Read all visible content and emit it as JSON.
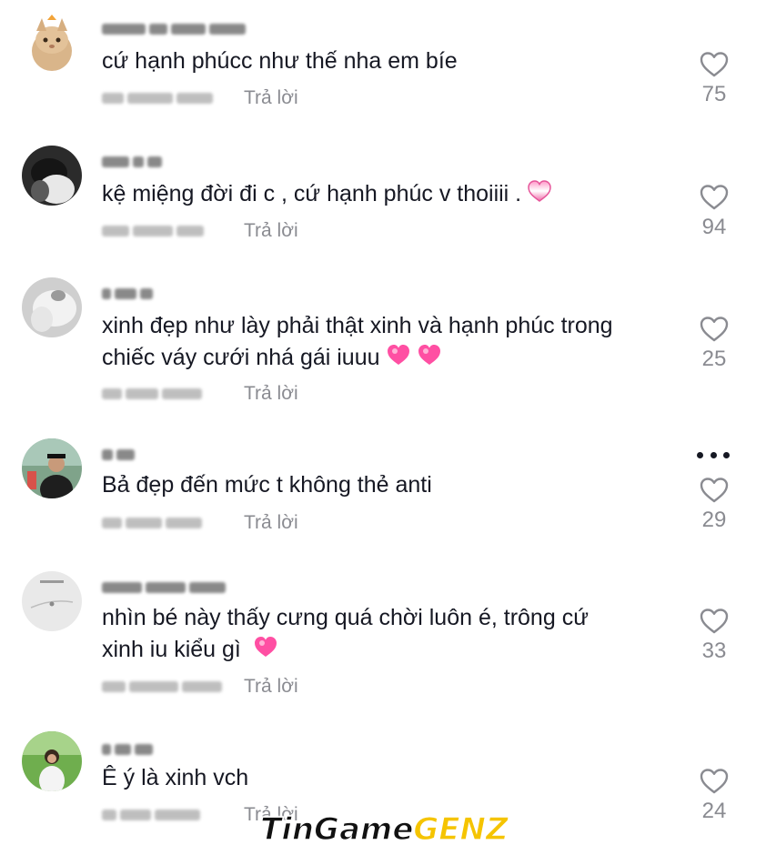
{
  "reply_label": "Trả lời",
  "comments": [
    {
      "text": "cứ hạnh phúcc như thế nha em bíe",
      "emoji": "",
      "likes": "75"
    },
    {
      "text": "kệ miệng đời đi c , cứ hạnh phúc v thoiiii .",
      "emoji": "pink-heart",
      "likes": "94"
    },
    {
      "text": "xinh đẹp như lày phải thật xinh và hạnh phúc trong\nchiếc váy cưới nhá gái iuuu",
      "emoji": "sparkling-heart x2",
      "likes": "25"
    },
    {
      "text": "Bả đẹp đến mức t không thẻ anti",
      "emoji": "",
      "likes": "29"
    },
    {
      "text": "nhìn bé này thấy cưng quá chời luôn é, trông cứ\nxinh iu kiểu gì ",
      "emoji": "sparkling-heart",
      "likes": "33"
    },
    {
      "text": "Ê ý là xinh vch",
      "emoji": "",
      "likes": "24"
    }
  ],
  "watermark": {
    "part1": "TinGame",
    "part2": "GENZ"
  },
  "colors": {
    "text": "#161823",
    "muted": "#8a8b91",
    "heart_pink": "#ff4fa3",
    "brand_yellow": "#f5c400"
  },
  "icons": {
    "like": "heart-outline-icon",
    "more": "more-dots-icon"
  }
}
